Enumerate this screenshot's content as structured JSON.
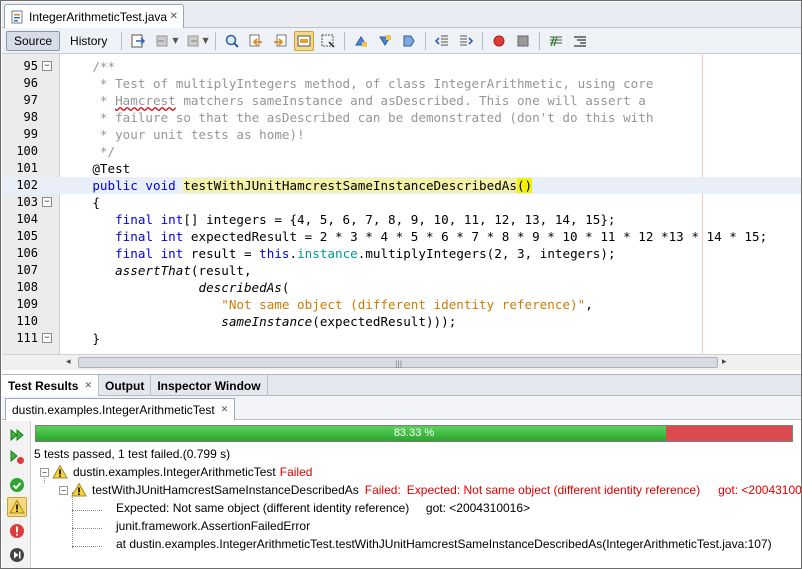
{
  "editor_tab": {
    "title": "IntegerArithmeticTest.java"
  },
  "toolbar": {
    "source_label": "Source",
    "history_label": "History"
  },
  "code_lines": [
    {
      "num": "95",
      "fold": "−"
    },
    {
      "num": "96"
    },
    {
      "num": "97"
    },
    {
      "num": "98"
    },
    {
      "num": "99"
    },
    {
      "num": "100"
    },
    {
      "num": "101"
    },
    {
      "num": "102"
    },
    {
      "num": "103",
      "fold": "−"
    },
    {
      "num": "104"
    },
    {
      "num": "105"
    },
    {
      "num": "106"
    },
    {
      "num": "107"
    },
    {
      "num": "108"
    },
    {
      "num": "109"
    },
    {
      "num": "110"
    },
    {
      "num": "111",
      "fold": "−"
    }
  ],
  "code": {
    "l95": "/**",
    "l96": " * Test of multiplyIntegers method, of class IntegerArithmetic, using core",
    "l97a": " * ",
    "l97b": "Hamcrest",
    "l97c": " matchers sameInstance and asDescribed. This one will assert a",
    "l98": " * failure so that the asDescribed can be demonstrated (don't do this with",
    "l99": " * your unit tests as home)!",
    "l100": " */",
    "l101": "@Test",
    "l102_kw": "public void ",
    "l102_name": "testWithJUnitHamcrestSameInstanceDescribedAs",
    "l102_paren": "()",
    "l103": "{",
    "l104_kw": "final int",
    "l104_rest": "[] integers = {4, 5, 6, 7, 8, 9, 10, 11, 12, 13, 14, 15};",
    "l105_kw": "final int",
    "l105_rest": " expectedResult = 2 * 3 * 4 * 5 * 6 * 7 * 8 * 9 * 10 * 11 * 12 *13 * 14 * 15;",
    "l106_kw": "final int",
    "l106_mid": " result = ",
    "l106_this": "this",
    "l106_dot": ".",
    "l106_field": "instance",
    "l106_rest": ".multiplyIntegers(2, 3, integers);",
    "l107_m": "assertThat",
    "l107_rest": "(result,",
    "l108_m": "describedAs",
    "l108_rest": "(",
    "l109_str": "\"Not same object (different identity reference)\"",
    "l109_rest": ",",
    "l110_m": "sameInstance",
    "l110_rest": "(expectedResult)));",
    "l111": "}"
  },
  "output_panel": {
    "tabs": [
      "Test Results",
      "Output",
      "Inspector Window"
    ],
    "subtab": "dustin.examples.IntegerArithmeticTest",
    "progress": {
      "label": "83.33 %",
      "fraction": 0.8333,
      "pass_color": "#3cb93c",
      "fail_color": "#dd4a50"
    },
    "summary": "5 tests passed, 1 test failed.(0.799 s)",
    "tree": {
      "suite_name": "dustin.examples.IntegerArithmeticTest",
      "suite_status": "Failed",
      "test_name": "testWithJUnitHamcrestSameInstanceDescribedAs",
      "test_status": "Failed:",
      "test_message": "Expected: Not same object (different identity reference)",
      "test_got": "got: <2004310016>",
      "detail_1": "Expected: Not same object (different identity reference)     got: <2004310016>",
      "detail_2": "junit.framework.AssertionFailedError",
      "detail_3": "at dustin.examples.IntegerArithmeticTest.testWithJUnitHamcrestSameInstanceDescribedAs(IntegerArithmeticTest.java:107)"
    }
  },
  "icons": {
    "file": "java-file-icon",
    "sidebar": [
      "rerun-icon",
      "rerun-failed-icon",
      "show-passed-icon",
      "show-failed-icon",
      "show-errors-icon",
      "show-aborted-icon"
    ],
    "tree": "warning-icon"
  }
}
